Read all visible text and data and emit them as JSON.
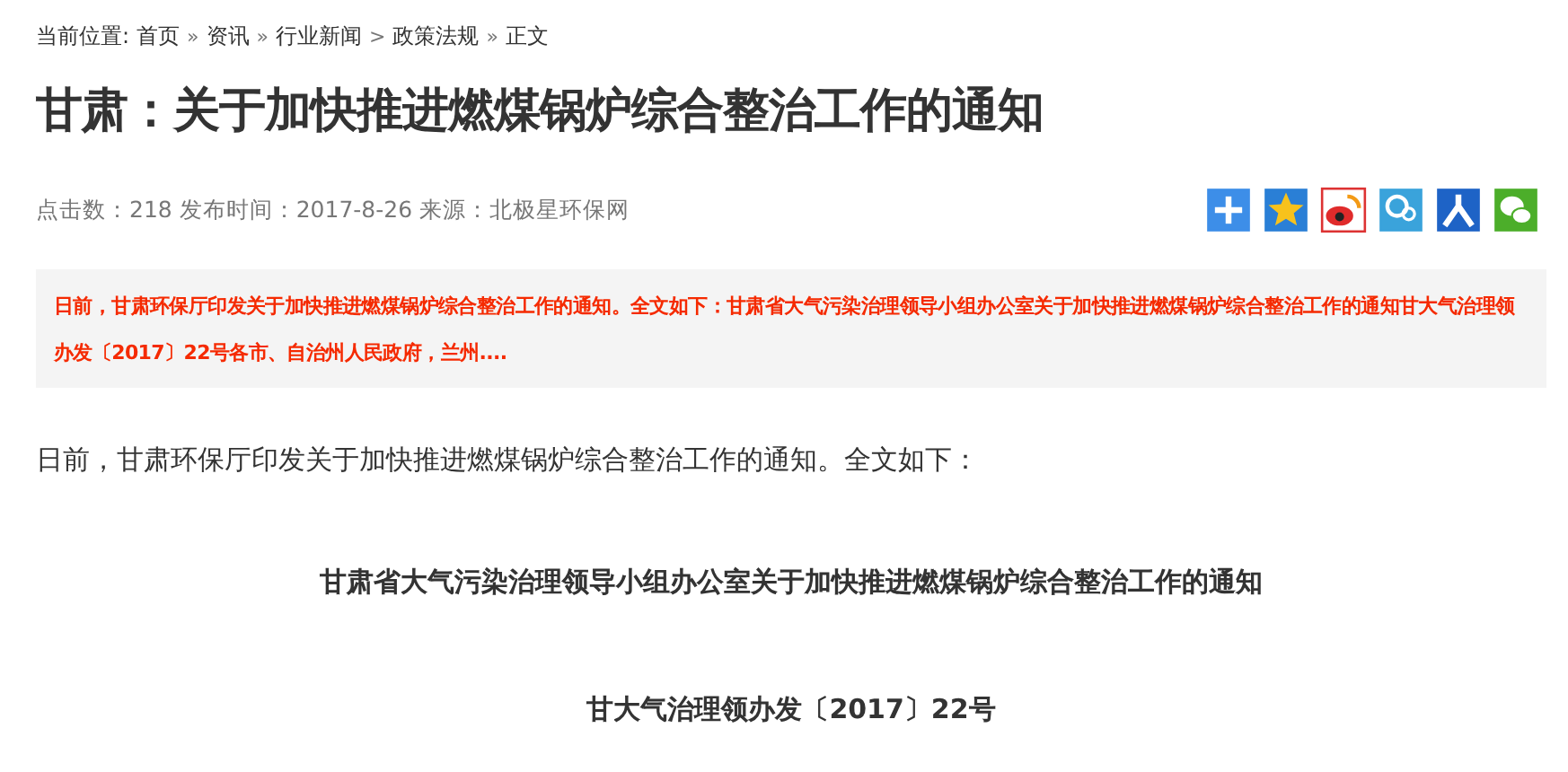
{
  "breadcrumb": {
    "label": "当前位置:",
    "items": [
      {
        "text": "首页",
        "sep": "»"
      },
      {
        "text": "资讯",
        "sep": "»"
      },
      {
        "text": "行业新闻",
        "sep": ">"
      },
      {
        "text": "政策法规",
        "sep": "»"
      },
      {
        "text": "正文"
      }
    ]
  },
  "title": "甘肃：关于加快推进燃煤锅炉综合整治工作的通知",
  "meta": "点击数：218 发布时间：2017-8-26 来源：北极星环保网",
  "summary": "日前，甘肃环保厅印发关于加快推进燃煤锅炉综合整治工作的通知。全文如下：甘肃省大气污染治理领导小组办公室关于加快推进燃煤锅炉综合整治工作的通知甘大气治理领办发〔2017〕22号各市、自治州人民政府，兰州....",
  "body": [
    {
      "kind": "paragraph",
      "text": "日前，甘肃环保厅印发关于加快推进燃煤锅炉综合整治工作的通知。全文如下："
    },
    {
      "kind": "heading",
      "text": "甘肃省大气污染治理领导小组办公室关于加快推进燃煤锅炉综合整治工作的通知"
    },
    {
      "kind": "heading",
      "text": "甘大气治理领办发〔2017〕22号"
    }
  ]
}
